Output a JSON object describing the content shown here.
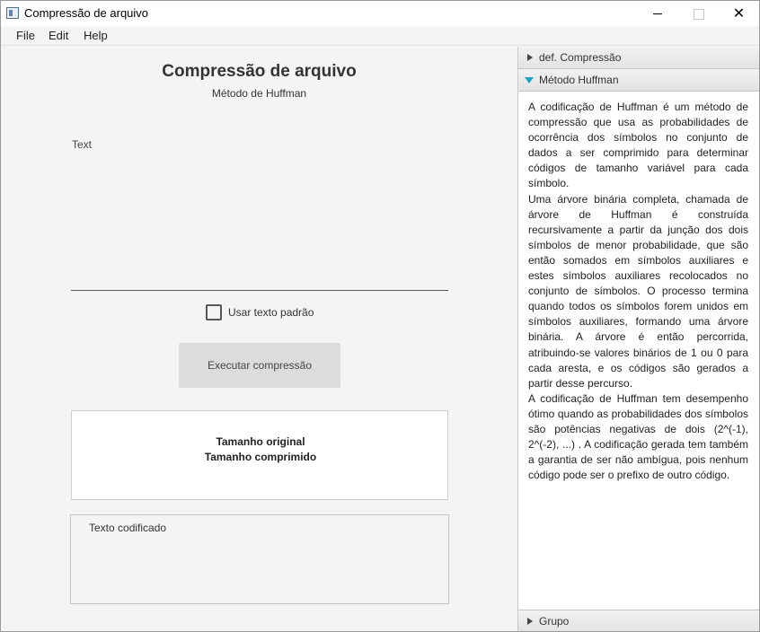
{
  "window": {
    "title": "Compressão de arquivo"
  },
  "menu": {
    "items": [
      "File",
      "Edit",
      "Help"
    ]
  },
  "main": {
    "title": "Compressão de arquivo",
    "subtitle": "Método de Huffman",
    "text_label": "Text",
    "checkbox_label": "Usar texto padrão",
    "checkbox_checked": false,
    "run_button": "Executar compressão",
    "result": {
      "original_label": "Tamanho original",
      "compressed_label": "Tamanho comprimido"
    },
    "encoded_label": "Texto codificado"
  },
  "accordion": {
    "panels": [
      {
        "title": "def. Compressão",
        "expanded": false
      },
      {
        "title": "Método Huffman",
        "expanded": true
      },
      {
        "title": "Grupo",
        "expanded": false
      }
    ],
    "huffman_paragraphs": [
      "A codificação de Huffman é um método de compressão que usa as probabilidades de ocorrência dos símbolos no conjunto de dados a ser comprimido para determinar códigos de tamanho variável para cada símbolo.",
      "Uma árvore binária completa, chamada de árvore de Huffman é construída recursivamente a partir da junção dos dois símbolos de menor probabilidade, que são então somados em símbolos auxiliares e estes símbolos auxiliares recolocados no conjunto de símbolos. O processo termina quando todos os símbolos forem unidos em símbolos auxiliares, formando uma árvore binária. A árvore é então percorrida, atribuindo-se valores binários de 1 ou 0 para cada aresta, e os códigos são gerados a partir desse percurso.",
      "A codificação de Huffman tem desempenho ótimo quando as probabilidades dos símbolos são potências negativas de dois (2^(-1), 2^(-2), ...) . A codificação gerada tem também a garantia de ser não ambígua, pois nenhum código pode ser o prefixo de outro código."
    ]
  },
  "colors": {
    "accent": "#1aa3c8",
    "button_bg": "#dcdcdc",
    "window_bg": "#f4f4f4"
  },
  "icons": {
    "app": "window-app-icon",
    "minimize": "minimize-icon",
    "maximize": "maximize-icon",
    "close": "close-icon",
    "collapsed": "triangle-right-icon",
    "expanded": "triangle-down-icon"
  }
}
